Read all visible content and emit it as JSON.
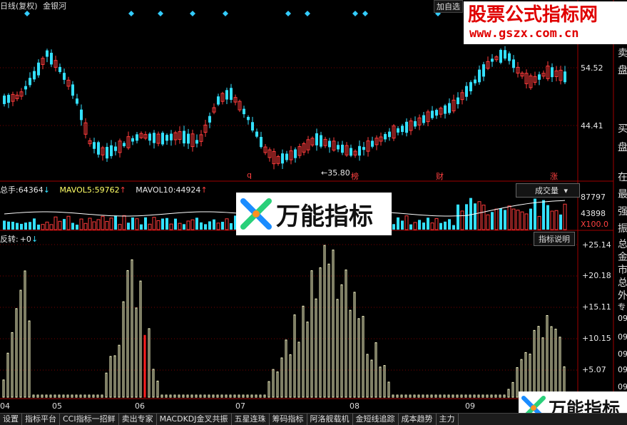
{
  "header": {
    "period": "日线(复权)",
    "stock_name": "金银河",
    "add_watch": "加自选"
  },
  "watermark": {
    "title": "股票公式指标网",
    "url": "www.gszx.com.cn"
  },
  "logo": {
    "text": "万能指标"
  },
  "price_panel": {
    "ticks": [
      "54.52",
      "44.41"
    ],
    "side_labels": [
      "卖",
      "盘",
      "买",
      "盘"
    ],
    "low_label": "35.80",
    "markers": [
      "q",
      "榜",
      "财",
      "涨"
    ],
    "colors": {
      "up": "#ff3b3b",
      "down": "#33e0ff",
      "ma": "#ffffff"
    }
  },
  "volume_panel": {
    "total_label": "总手:",
    "total_value": "64364",
    "mavol5_label": "MAVOL5:",
    "mavol5_value": "59762",
    "mavol10_label": "MAVOL10:",
    "mavol10_value": "44924",
    "selector": "成交量",
    "ticks": [
      "87797",
      "43898",
      "X100.0"
    ],
    "side_labels": [
      "在",
      "最",
      "强",
      "振"
    ]
  },
  "indicator_panel": {
    "name": "反转:",
    "value": "+0",
    "explain_button": "指标说明",
    "ticks": [
      "+25.14",
      "+20.18",
      "+15.11",
      "+10.15",
      "+5.07"
    ],
    "side_labels": [
      "总",
      "金",
      "市",
      "总",
      "外",
      "专"
    ],
    "side_partial": [
      "09",
      "09",
      "09",
      "09",
      "09",
      "09"
    ]
  },
  "x_axis": {
    "months": [
      "04",
      "05",
      "06",
      "07",
      "08",
      "09"
    ]
  },
  "bottom_tabs": [
    "设置",
    "指标平台",
    "CCI指标一招鲜",
    "卖出专家",
    "MACDKDJ金叉共振",
    "五星连珠",
    "筹码指标",
    "阿洛舰载机",
    "金短线追踪",
    "成本趋势",
    "主力"
  ]
}
